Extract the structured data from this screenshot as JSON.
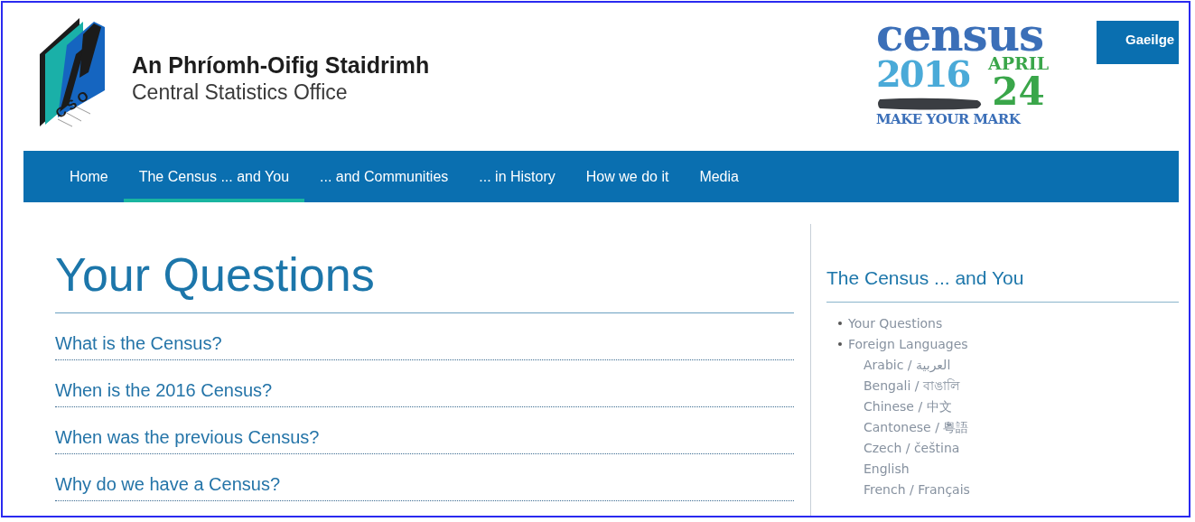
{
  "header": {
    "logo_letters": "CSO",
    "title_irish": "An Phríomh-Oifig Staidrimh",
    "title_english": "Central Statistics Office",
    "census_logo": {
      "word": "census",
      "year": "2016",
      "month": "APRIL",
      "day": "24",
      "slogan": "MAKE YOUR MARK"
    },
    "language_button": "Gaeilge"
  },
  "nav": [
    {
      "label": "Home",
      "selected": false
    },
    {
      "label": "The Census ... and You",
      "selected": true
    },
    {
      "label": "... and Communities",
      "selected": false
    },
    {
      "label": "... in History",
      "selected": false
    },
    {
      "label": "How we do it",
      "selected": false
    },
    {
      "label": "Media",
      "selected": false
    }
  ],
  "main": {
    "heading": "Your Questions",
    "questions": [
      "What is the Census?",
      "When is the 2016 Census?",
      "When was the previous Census?",
      "Why do we have a Census?"
    ]
  },
  "sidebar": {
    "heading": "The Census ... and You",
    "items": [
      {
        "label": "Your Questions"
      },
      {
        "label": "Foreign Languages",
        "children": [
          {
            "label": "Arabic / العربية"
          },
          {
            "label": "Bengali / বাঙালি"
          },
          {
            "label": "Chinese / 中文"
          },
          {
            "label": "Cantonese / 粵語"
          },
          {
            "label": "Czech / čeština"
          },
          {
            "label": "English"
          },
          {
            "label": "French / Français"
          }
        ]
      }
    ]
  }
}
